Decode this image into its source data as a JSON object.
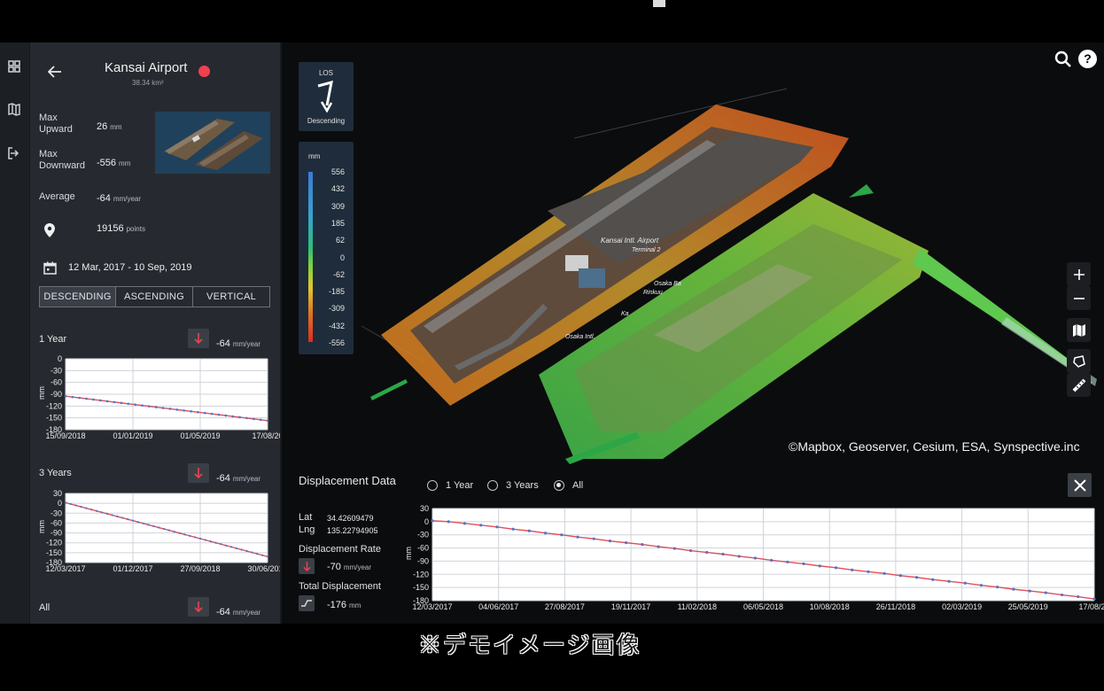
{
  "site": {
    "name": "Kansai Airport",
    "area": "38.34 km²",
    "status_color": "#f0404f"
  },
  "stats": {
    "max_upward_label": "Max\nUpward",
    "max_upward_value": "26",
    "max_upward_unit": "mm",
    "max_downward_label": "Max\nDownward",
    "max_downward_value": "-556",
    "max_downward_unit": "mm",
    "average_label": "Average",
    "average_value": "-64",
    "average_unit": "mm/year",
    "points_value": "19156",
    "points_unit": "points",
    "date_range": "12 Mar, 2017 - 10 Sep, 2019"
  },
  "orbit_tabs": [
    {
      "label": "DESCENDING",
      "active": true
    },
    {
      "label": "ASCENDING",
      "active": false
    },
    {
      "label": "VERTICAL",
      "active": false
    }
  ],
  "mini_charts": [
    {
      "label": "1 Year",
      "rate": "-64",
      "rate_unit": "mm/year",
      "y_ticks": [
        "0",
        "-30",
        "-60",
        "-90",
        "-120",
        "-150",
        "-180"
      ],
      "x_ticks": [
        "15/09/2018",
        "01/01/2019",
        "01/05/2019",
        "17/08/20"
      ],
      "ylabel": "mm",
      "start": -95,
      "end": -157,
      "ymin": -180,
      "ymax": 0
    },
    {
      "label": "3 Years",
      "rate": "-64",
      "rate_unit": "mm/year",
      "y_ticks": [
        "30",
        "0",
        "-30",
        "-60",
        "-90",
        "-120",
        "-150",
        "-180"
      ],
      "x_ticks": [
        "12/03/2017",
        "01/12/2017",
        "27/09/2018",
        "30/06/2019"
      ],
      "ylabel": "mm",
      "start": 2,
      "end": -162,
      "ymin": -180,
      "ymax": 30
    },
    {
      "label": "All",
      "rate": "-64",
      "rate_unit": "mm/year"
    }
  ],
  "los": {
    "label": "LOS",
    "direction": "Descending"
  },
  "legend": {
    "unit": "mm",
    "values": [
      "556",
      "432",
      "309",
      "185",
      "62",
      "0",
      "-62",
      "-185",
      "-309",
      "-432",
      "-556"
    ]
  },
  "map": {
    "attribution": "©Mapbox, Geoserver, Cesium, ESA, Synspective.inc",
    "labels": [
      "Kansai Intl. Airport",
      "Terminal 2",
      "Osaka Ba",
      "Rinkuu",
      "Osaka Intl.",
      "Ka"
    ]
  },
  "map_controls": [
    "search-icon",
    "help-icon",
    "zoom-in-icon",
    "zoom-out-icon",
    "layers-icon",
    "polygon-icon",
    "ruler-icon"
  ],
  "displacement": {
    "title": "Displacement Data",
    "lat_label": "Lat",
    "lat": "34.42609479",
    "lng_label": "Lng",
    "lng": "135.22794905",
    "rate_label": "Displacement Rate",
    "rate": "-70",
    "rate_unit": "mm/year",
    "total_label": "Total Displacement",
    "total": "-176",
    "total_unit": "mm",
    "ranges": [
      {
        "label": "1 Year",
        "selected": false
      },
      {
        "label": "3 Years",
        "selected": false
      },
      {
        "label": "All",
        "selected": true
      }
    ]
  },
  "chart_data": {
    "type": "line",
    "ylabel": "mm",
    "ylim": [
      -180,
      30
    ],
    "y_ticks": [
      "30",
      "0",
      "-30",
      "-60",
      "-90",
      "-120",
      "-150",
      "-180"
    ],
    "x_ticks": [
      "12/03/2017",
      "04/06/2017",
      "27/08/2017",
      "19/11/2017",
      "11/02/2018",
      "06/05/2018",
      "10/08/2018",
      "26/11/2018",
      "02/03/2019",
      "25/05/2019",
      "17/08/20"
    ],
    "series": [
      {
        "values": [
          2,
          0,
          -4,
          -8,
          -12,
          -17,
          -21,
          -26,
          -30,
          -35,
          -39,
          -44,
          -48,
          -52,
          -57,
          -61,
          -66,
          -70,
          -74,
          -79,
          -83,
          -88,
          -92,
          -96,
          -101,
          -105,
          -110,
          -114,
          -118,
          -123,
          -127,
          -132,
          -136,
          -140,
          -145,
          -149,
          -154,
          -158,
          -162,
          -167,
          -171,
          -176
        ]
      }
    ]
  },
  "caption": "※デモイメージ画像"
}
